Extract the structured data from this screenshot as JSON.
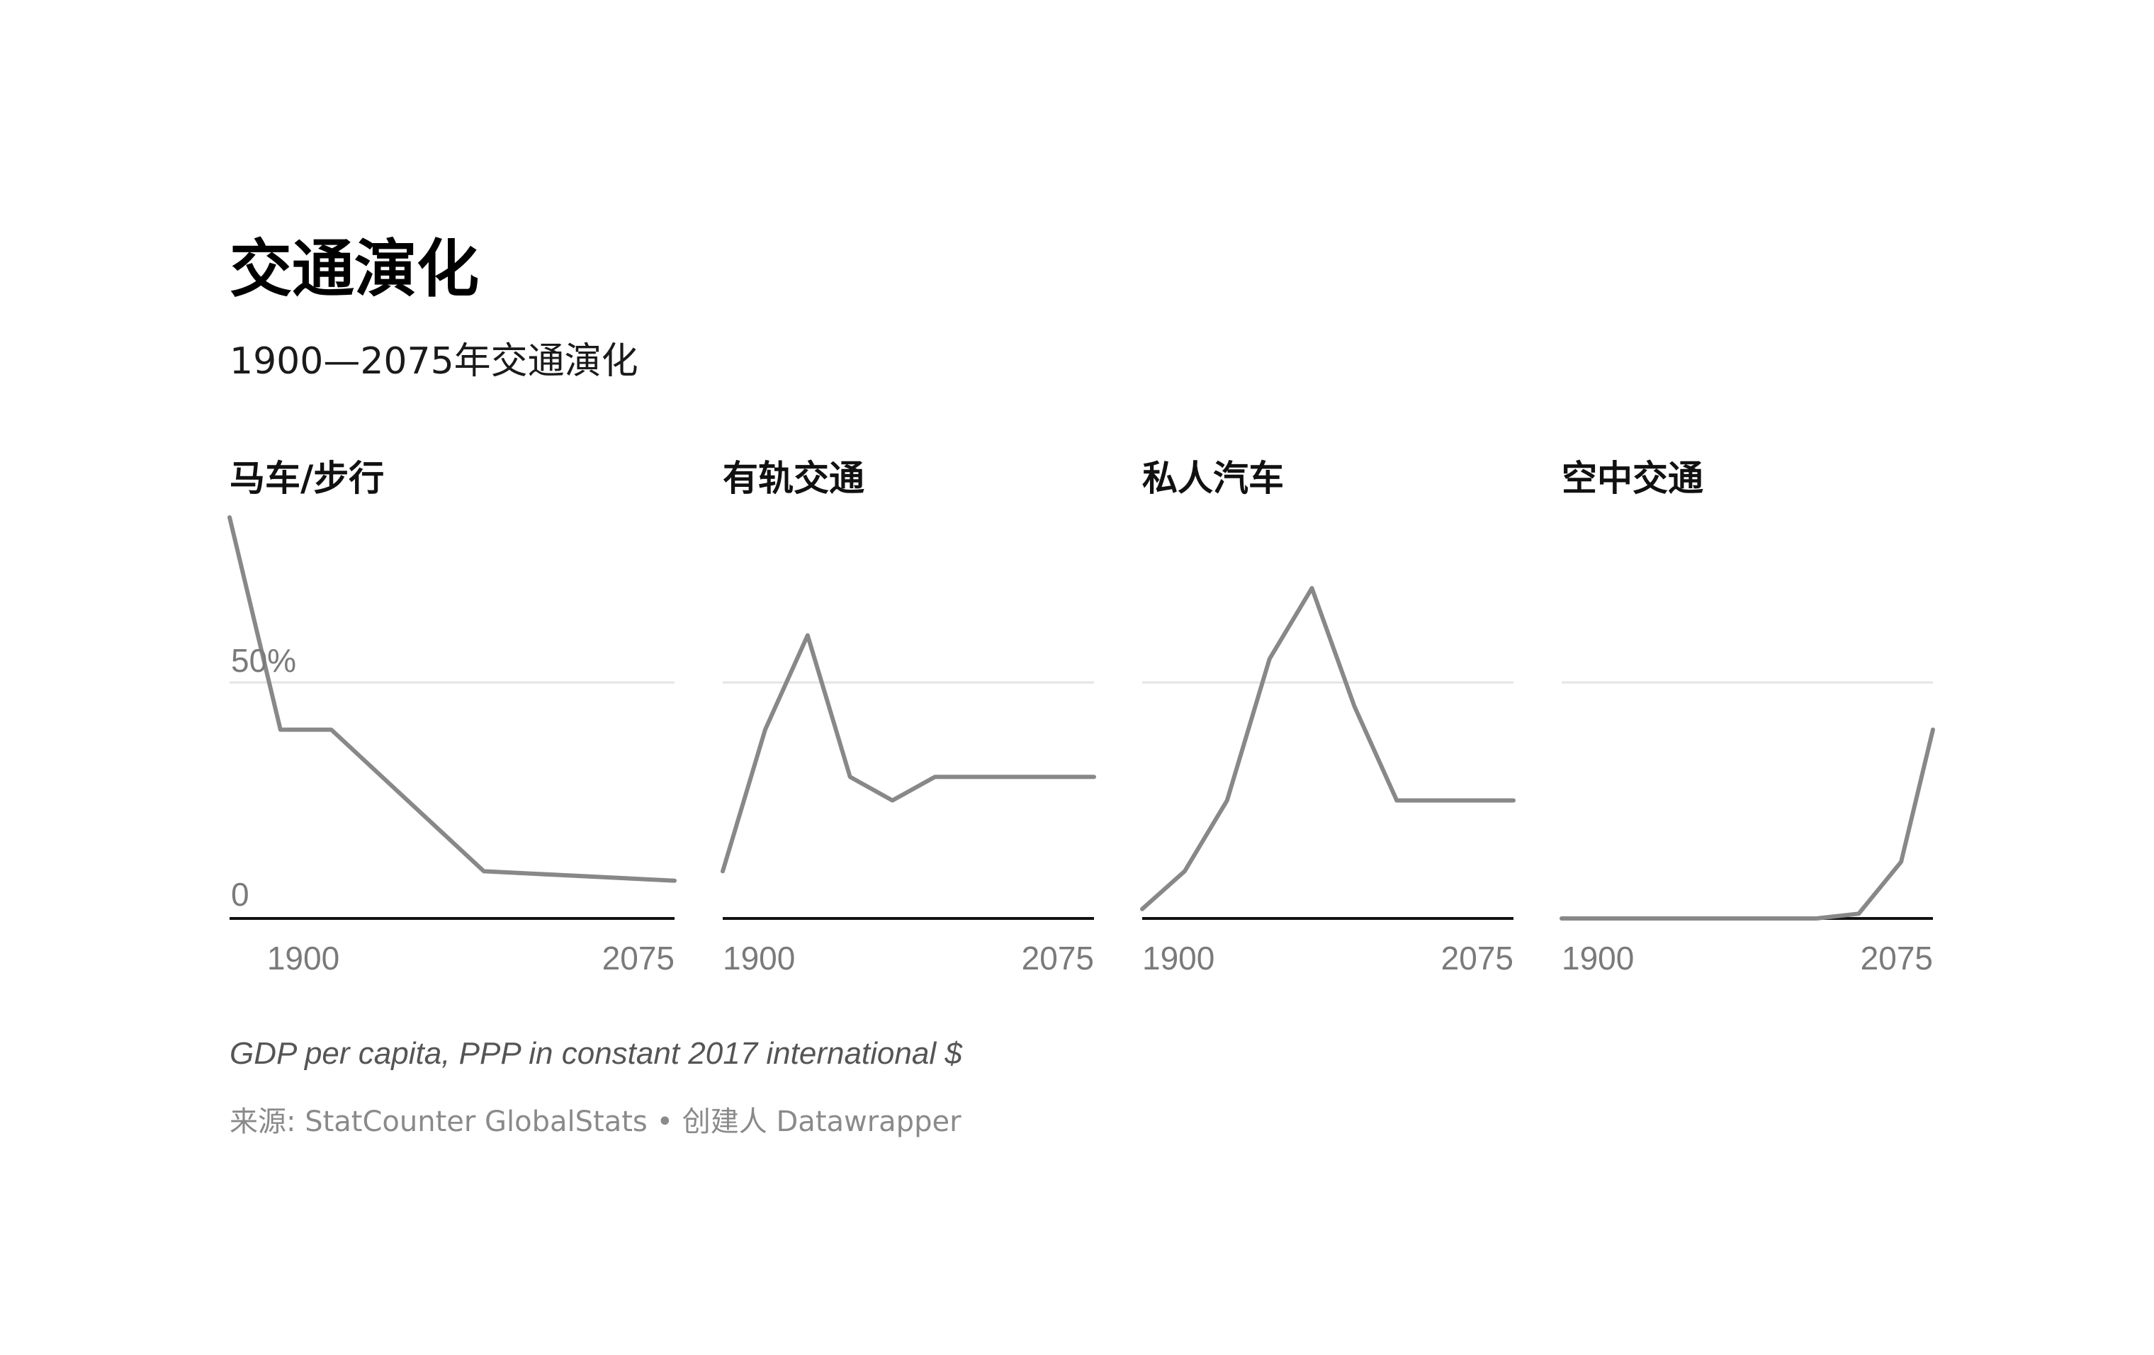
{
  "title": "交通演化",
  "subtitle": "1900—2075年交通演化",
  "note": "GDP per capita, PPP in constant 2017 international $",
  "source": {
    "prefix": "来源:",
    "name": "StatCounter GlobalStats",
    "separator": "•",
    "creator_prefix": "创建人",
    "creator": "Datawrapper"
  },
  "colors": {
    "line": "#888888",
    "gridline": "#e4e4e4",
    "baseline": "#111111",
    "tick_text": "#7a7a7a"
  },
  "chart_data": {
    "type": "line",
    "layout": "small-multiples",
    "x_tick_labels": [
      "1900",
      "2075"
    ],
    "y_tick_labels": [
      "0",
      "50%"
    ],
    "y_ticks": [
      0,
      50
    ],
    "ylim": [
      0,
      85
    ],
    "xlim": [
      1900,
      2075
    ],
    "grid": true,
    "series": [
      {
        "name": "马车/步行",
        "x": [
          1900,
          1920,
          1940,
          2000,
          2075
        ],
        "values": [
          85,
          40,
          40,
          10,
          8
        ]
      },
      {
        "name": "有轨交通",
        "x": [
          1900,
          1920,
          1940,
          1960,
          1980,
          2000,
          2075
        ],
        "values": [
          10,
          40,
          60,
          30,
          25,
          30,
          30
        ]
      },
      {
        "name": "私人汽车",
        "x": [
          1900,
          1920,
          1940,
          1960,
          1980,
          2000,
          2020,
          2075
        ],
        "values": [
          2,
          10,
          25,
          55,
          70,
          45,
          25,
          25
        ]
      },
      {
        "name": "空中交通",
        "x": [
          1900,
          2000,
          2020,
          2040,
          2060,
          2075
        ],
        "values": [
          0,
          0,
          0,
          1,
          12,
          40
        ]
      }
    ]
  }
}
